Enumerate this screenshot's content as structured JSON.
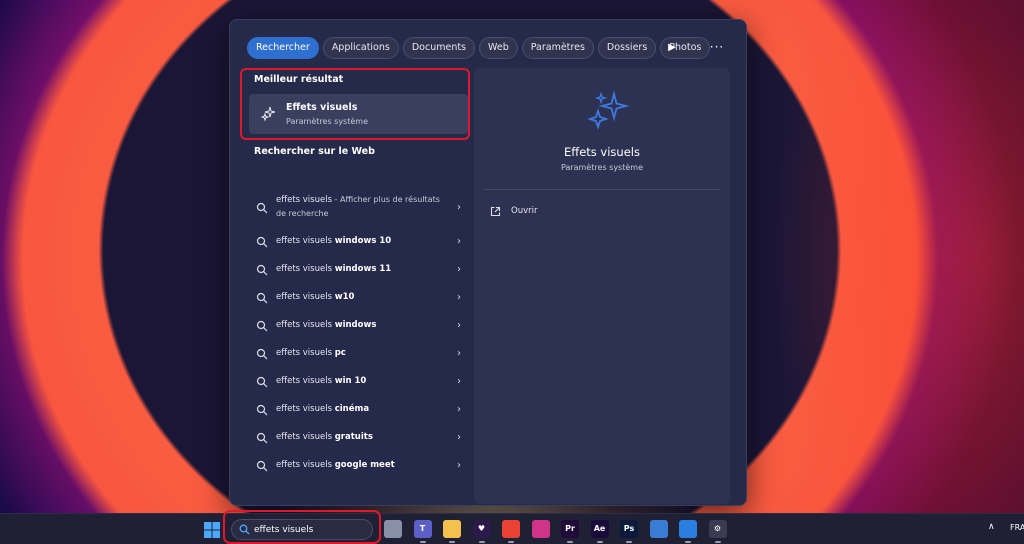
{
  "tabs": [
    {
      "label": "Rechercher",
      "active": true
    },
    {
      "label": "Applications"
    },
    {
      "label": "Documents"
    },
    {
      "label": "Web"
    },
    {
      "label": "Paramètres"
    },
    {
      "label": "Dossiers"
    },
    {
      "label": "Photos"
    }
  ],
  "tab_more": "···",
  "best_result": {
    "section_title": "Meilleur résultat",
    "title": "Effets visuels",
    "subtitle": "Paramètres système",
    "icon": "sparkle-icon"
  },
  "web_search": {
    "section_title": "Rechercher sur le Web",
    "first": {
      "query": "effets visuels",
      "suffix": " - Afficher plus de résultats de recherche"
    },
    "items": [
      {
        "prefix": "effets visuels ",
        "bold": "windows 10"
      },
      {
        "prefix": "effets visuels ",
        "bold": "windows 11"
      },
      {
        "prefix": "effets visuels ",
        "bold": "w10"
      },
      {
        "prefix": "effets visuels ",
        "bold": "windows"
      },
      {
        "prefix": "effets visuels ",
        "bold": "pc"
      },
      {
        "prefix": "effets visuels ",
        "bold": "win 10"
      },
      {
        "prefix": "effets visuels ",
        "bold": "cinéma"
      },
      {
        "prefix": "effets visuels ",
        "bold": "gratuits"
      },
      {
        "prefix": "effets visuels ",
        "bold": "google meet"
      }
    ]
  },
  "preview": {
    "title": "Effets visuels",
    "subtitle": "Paramètres système",
    "open_label": "Ouvrir"
  },
  "taskbar": {
    "search_value": "effets visuels",
    "apps": [
      {
        "name": "file-viewer",
        "label": "",
        "color": "#8a8fa8"
      },
      {
        "name": "teams",
        "label": "T",
        "color": "#5b5fc7"
      },
      {
        "name": "file-explorer",
        "label": "",
        "color": "#f2c14e"
      },
      {
        "name": "app-heart",
        "label": "♥",
        "color": "#2b1a4a"
      },
      {
        "name": "chrome",
        "label": "",
        "color": "#e94235"
      },
      {
        "name": "app-kite",
        "label": "",
        "color": "#d0348a"
      },
      {
        "name": "premiere-pro",
        "label": "Pr",
        "color": "#1f0a3a"
      },
      {
        "name": "after-effects",
        "label": "Ae",
        "color": "#1a0a3a"
      },
      {
        "name": "photoshop",
        "label": "Ps",
        "color": "#0b1a3a"
      },
      {
        "name": "copilot",
        "label": "",
        "color": "#3a7bd5"
      },
      {
        "name": "photos",
        "label": "",
        "color": "#2a7de1"
      },
      {
        "name": "settings",
        "label": "⚙",
        "color": "#3a3b52"
      }
    ],
    "tray_language": "FRA"
  },
  "colors": {
    "accent": "#2f6fd0",
    "highlight": "#e0182a"
  }
}
